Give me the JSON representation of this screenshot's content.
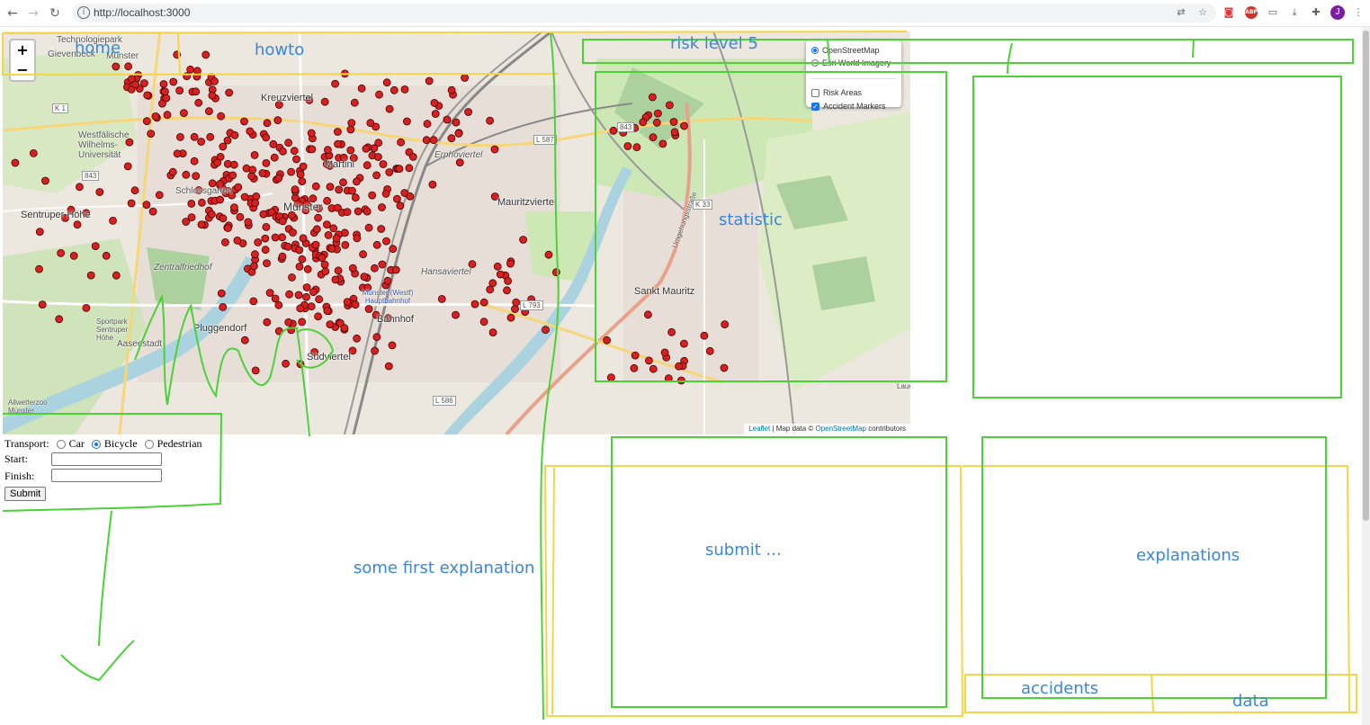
{
  "browser": {
    "url": "http://localhost:3000",
    "profile_initial": "J",
    "extension_abp": "ABP",
    "icons": [
      "back-arrow-icon",
      "forward-arrow-icon",
      "reload-icon",
      "info-icon",
      "translate-icon",
      "star-icon",
      "pocket-icon",
      "adblock-icon",
      "document-icon",
      "download-icon",
      "puzzle-icon",
      "menu-dots-icon"
    ]
  },
  "map": {
    "zoom_in": "+",
    "zoom_out": "−",
    "districts": [
      "Technologiepark",
      "Gievenbeck",
      "Münster",
      "Kreuzviertel",
      "Westfälische Wilhelms-Universität",
      "Schlossgarten",
      "Martini",
      "Erphoviertel",
      "Mauritzviertel",
      "Münster",
      "Sentruper Höhe",
      "Zentralfriedhof",
      "Aaseestadt",
      "Sportpark Sentruper Höhe",
      "Pluggendorf",
      "Südviertel",
      "Bahnhof",
      "Münster (Westf) Hauptbahnhof",
      "Hansaviertel",
      "Sankt Mauritz",
      "Allwetterzoo Münster",
      "Lauerwiese"
    ],
    "road_labels": [
      "K 1",
      "843",
      "L 587",
      "843",
      "K 33",
      "L 793",
      "L 586",
      "Umgehungsstraße"
    ],
    "layers": {
      "base": [
        {
          "label": "OpenStreetMap",
          "selected": true
        },
        {
          "label": "Esri World Imagery",
          "selected": false
        }
      ],
      "overlays": [
        {
          "label": "Risk Areas",
          "checked": false
        },
        {
          "label": "Accident Markers",
          "checked": true
        }
      ]
    },
    "attribution": {
      "leaflet": "Leaflet",
      "separator": " | Map data © ",
      "osm": "OpenStreetMap",
      "suffix": " contributors"
    },
    "marker_color": "#d92020"
  },
  "form": {
    "transport_label": "Transport:",
    "options": [
      {
        "label": "Car",
        "selected": false
      },
      {
        "label": "Bicycle",
        "selected": true
      },
      {
        "label": "Pedestrian",
        "selected": false
      }
    ],
    "start_label": "Start:",
    "start_value": "",
    "finish_label": "Finish:",
    "finish_value": "",
    "submit_label": "Submit"
  },
  "annotations": {
    "home": "home",
    "howto": "howto",
    "risk_level": "risk level 5",
    "statistic": "statistic",
    "first_explanation": "some first explanation",
    "submit": "submit ...",
    "explanations": "explanations",
    "accidents": "accidents",
    "data": "data",
    "colors": {
      "green": "#4cd137",
      "yellow": "#f5d547",
      "blue": "#3a86d8"
    }
  }
}
